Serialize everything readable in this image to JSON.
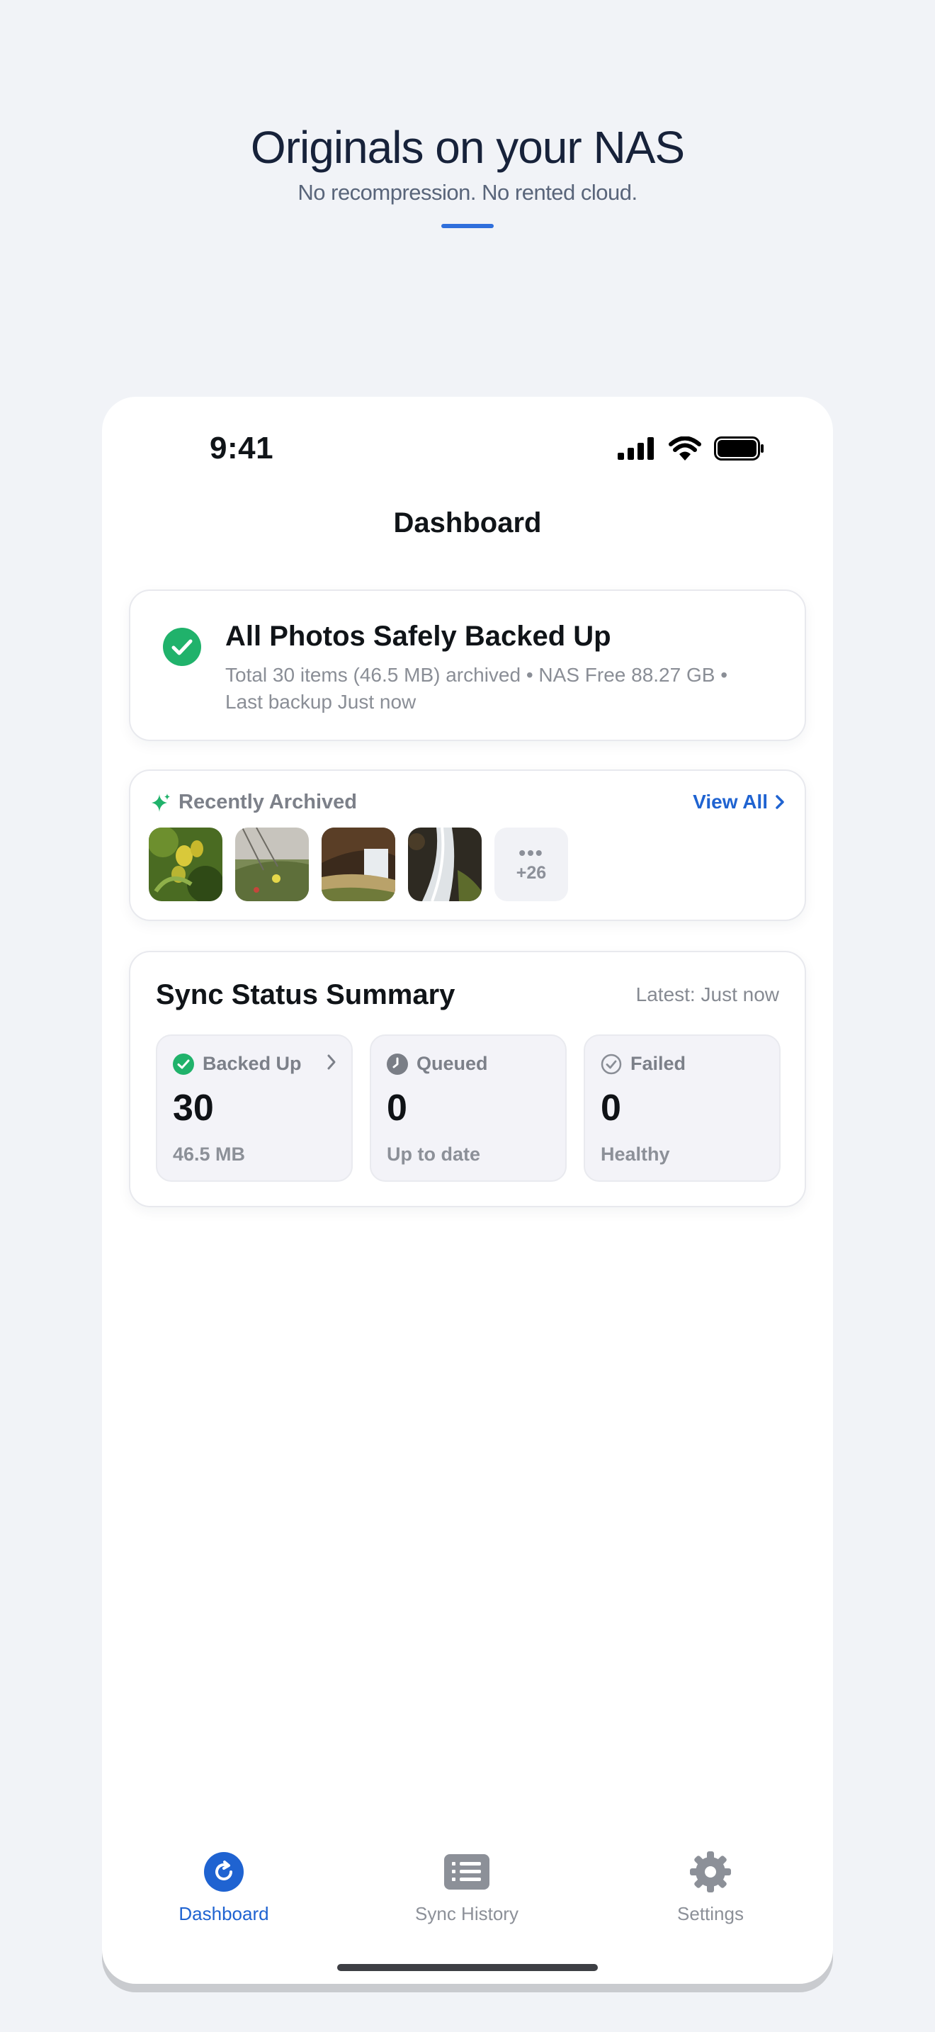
{
  "hero": {
    "title": "Originals on your NAS",
    "subtitle": "No recompression. No rented cloud.",
    "accent_color": "#2f6fdc"
  },
  "status_bar": {
    "time": "9:41",
    "icons": [
      "cellular-signal-icon",
      "wifi-icon",
      "battery-icon"
    ]
  },
  "nav": {
    "title": "Dashboard"
  },
  "backup_card": {
    "icon": "check-circle-icon",
    "title": "All Photos Safely Backed Up",
    "description": "Total 30 items (46.5 MB) archived • NAS Free 88.27 GB • Last backup Just now",
    "status_color": "#20b26b"
  },
  "recent": {
    "icon": "sparkle-icon",
    "label": "Recently Archived",
    "view_all": "View All",
    "thumbnails": [
      "photo-flowers",
      "photo-meadow",
      "photo-waterfall-cliff",
      "photo-waterfall-stream"
    ],
    "more_count": "+26"
  },
  "sync": {
    "title": "Sync Status Summary",
    "latest": "Latest: Just now",
    "tiles": [
      {
        "label": "Backed Up",
        "value": "30",
        "sub": "46.5 MB",
        "icon": "check-circle-icon",
        "color": "#20b26b"
      },
      {
        "label": "Queued",
        "value": "0",
        "sub": "Up to date",
        "icon": "clock-icon",
        "color": "#7a7e86"
      },
      {
        "label": "Failed",
        "value": "0",
        "sub": "Healthy",
        "icon": "check-outline-icon",
        "color": "#8a8e96"
      }
    ]
  },
  "tabbar": {
    "active_color": "#1f63d1",
    "inactive_color": "#8c9098",
    "tabs": [
      {
        "label": "Dashboard",
        "icon": "refresh-circle-icon",
        "active": true
      },
      {
        "label": "Sync History",
        "icon": "list-icon",
        "active": false
      },
      {
        "label": "Settings",
        "icon": "gear-icon",
        "active": false
      }
    ]
  }
}
